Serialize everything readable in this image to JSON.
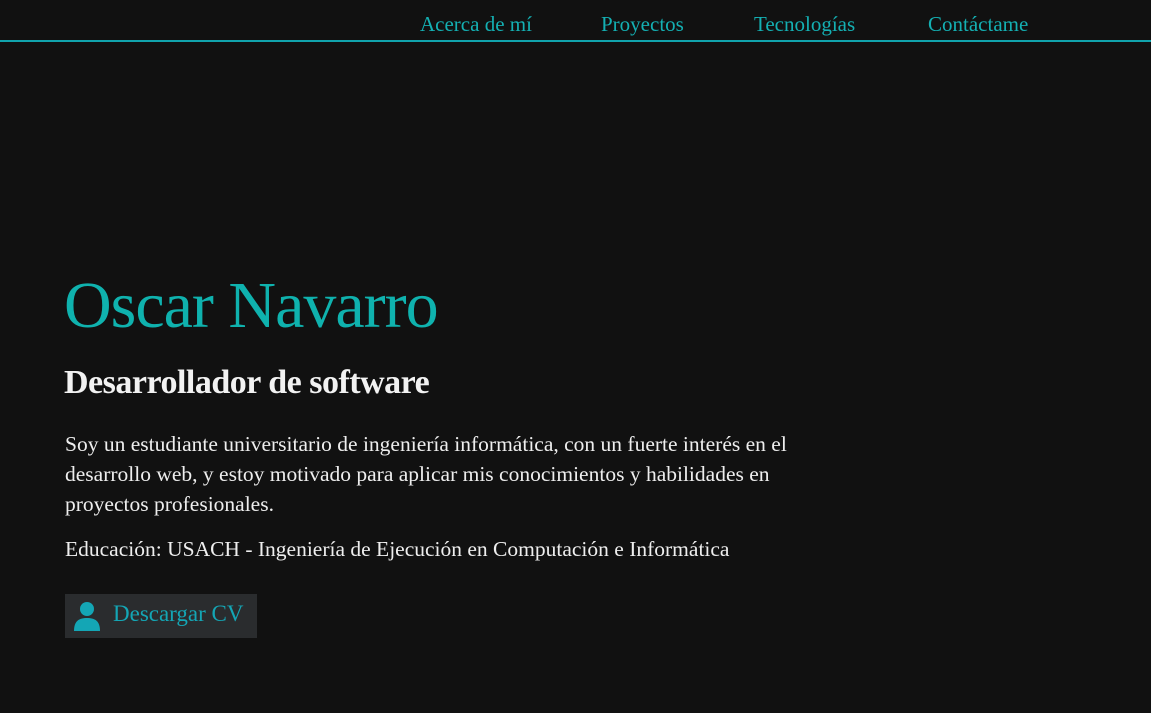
{
  "nav": {
    "items": [
      {
        "label": "Acerca de mí"
      },
      {
        "label": "Proyectos"
      },
      {
        "label": "Tecnologías"
      },
      {
        "label": "Contáctame"
      }
    ]
  },
  "hero": {
    "name": "Oscar Navarro",
    "role": "Desarrollador de software",
    "bio": "Soy un estudiante universitario de ingeniería informática, con un fuerte interés en el desarrollo web, y estoy motivado para aplicar mis conocimientos y habilidades en proyectos profesionales.",
    "education": "Educación: USACH - Ingeniería de Ejecución en Computación e Informática",
    "cv_button": {
      "label": "Descargar CV",
      "icon": "user-icon"
    }
  },
  "colors": {
    "background": "#111111",
    "accent": "#0fb2ae",
    "text": "#eeeeee",
    "button_bg": "#2a2c2e"
  }
}
